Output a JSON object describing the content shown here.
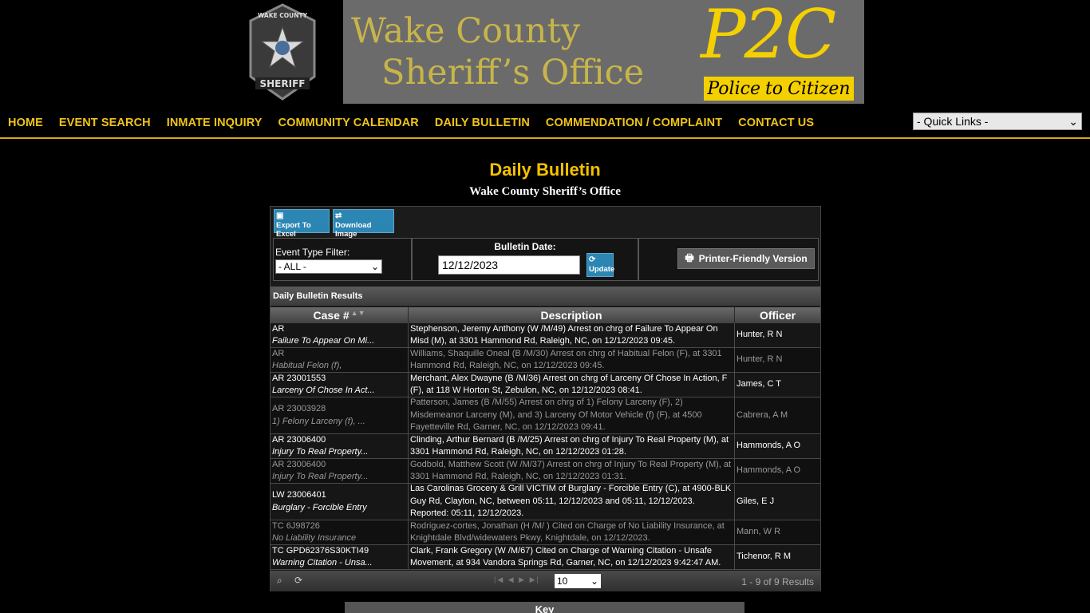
{
  "header": {
    "badge_top": "WAKE COUNTY",
    "badge_bottom": "SHERIFF",
    "banner_line1": "Wake County",
    "banner_line2": "Sheriff’s Office",
    "p2c": "P2C",
    "p2c_tagline": [
      "Police",
      "to",
      "Citizen"
    ]
  },
  "nav": {
    "items": [
      "HOME",
      "EVENT SEARCH",
      "INMATE INQUIRY",
      "COMMUNITY CALENDAR",
      "DAILY BULLETIN",
      "COMMENDATION / COMPLAINT",
      "CONTACT US"
    ],
    "quick_links": "- Quick Links -"
  },
  "page": {
    "title": "Daily Bulletin",
    "subtitle": "Wake County Sheriff’s Office"
  },
  "toolbar": {
    "export_label": "Export To Excel",
    "download_label": "Download Image"
  },
  "filters": {
    "event_type_label": "Event Type Filter:",
    "event_type_value": "- ALL -",
    "bulletin_date_label": "Bulletin Date:",
    "bulletin_date_value": "12/12/2023",
    "update_label": "Update",
    "printer_label": "Printer-Friendly Version"
  },
  "results": {
    "title": "Daily Bulletin Results",
    "columns": [
      "Case #",
      "Description",
      "Officer"
    ],
    "rows": [
      {
        "case": "AR",
        "type": "Failure To Appear On Mi...",
        "desc": "Stephenson, Jeremy Anthony (W /M/49) Arrest on chrg of Failure To Appear On Misd (M), at 3301 Hammond Rd, Raleigh, NC, on 12/12/2023 09:45.",
        "officer": "Hunter, R N"
      },
      {
        "case": "AR",
        "type": "Habitual Felon (f),",
        "desc": "Williams, Shaquille Oneal (B /M/30) Arrest on chrg of Habitual Felon (F), at 3301 Hammond Rd, Raleigh, NC, on 12/12/2023 09:45.",
        "officer": "Hunter, R N"
      },
      {
        "case": "AR 23001553",
        "type": "Larceny Of Chose In Act...",
        "desc": "Merchant, Alex Dwayne (B /M/36) Arrest on chrg of Larceny Of Chose In Action, F (F), at 118 W Horton St, Zebulon, NC, on 12/12/2023 08:41.",
        "officer": "James, C T"
      },
      {
        "case": "AR 23003928",
        "type": "1) Felony Larceny (f), ...",
        "desc": "Patterson, James (B /M/55) Arrest on chrg of 1) Felony Larceny (F), 2) Misdemeanor Larceny (M), and 3) Larceny Of Motor Vehicle (f) (F), at 4500 Fayetteville Rd, Garner, NC, on 12/12/2023 09:41.",
        "officer": "Cabrera, A M"
      },
      {
        "case": "AR 23006400",
        "type": "Injury To Real Property...",
        "desc": "Clinding, Arthur Bernard (B /M/25) Arrest on chrg of Injury To Real Property (M), at 3301 Hammond Rd, Raleigh, NC, on 12/12/2023 01:28.",
        "officer": "Hammonds, A O"
      },
      {
        "case": "AR 23006400",
        "type": "Injury To Real Property...",
        "desc": "Godbold, Matthew Scott (W /M/37) Arrest on chrg of Injury To Real Property (M), at 3301 Hammond Rd, Raleigh, NC, on 12/12/2023 01:31.",
        "officer": "Hammonds, A O"
      },
      {
        "case": "LW 23006401",
        "type": "Burglary - Forcible Entry",
        "desc": "Las Carolinas Grocery & Grill VICTIM of Burglary - Forcible Entry (C), at 4900-BLK Guy Rd, Clayton, NC, between 05:11, 12/12/2023 and 05:11, 12/12/2023. Reported: 05:11, 12/12/2023.",
        "officer": "Giles, E J"
      },
      {
        "case": "TC 6J98726",
        "type": "No Liability Insurance",
        "desc": "Rodriguez-cortes, Jonathan (H /M/ ) Cited on Charge of No Liability Insurance, at Knightdale Blvd/widewaters Pkwy, Knightdale, on 12/12/2023.",
        "officer": "Mann, W R"
      },
      {
        "case": "TC GPD62376S30KTI49",
        "type": "Warning Citation - Unsa...",
        "desc": "Clark, Frank Gregory (W /M/67) Cited on Charge of Warning Citation - Unsafe Movement, at 934 Vandora Springs Rd, Garner, NC, on 12/12/2023 9:42:47 AM.",
        "officer": "Tichenor, R M"
      }
    ]
  },
  "pager": {
    "page_size": "10",
    "info": "1 - 9 of 9 Results"
  },
  "key": {
    "label": "Key"
  }
}
